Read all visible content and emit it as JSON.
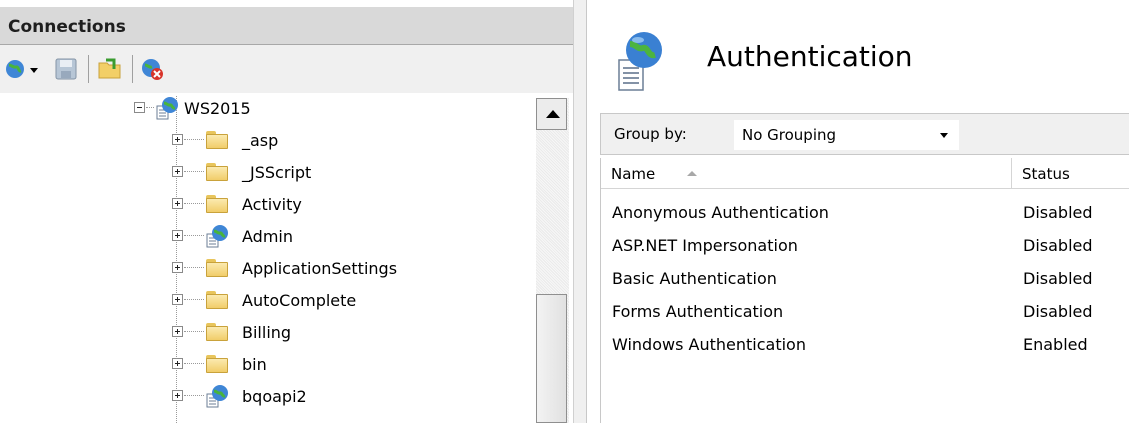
{
  "connections": {
    "title": "Connections",
    "toolbar": [
      {
        "icon": "connect-globe-icon"
      },
      {
        "icon": "save-icon"
      },
      {
        "icon": "open-folder-icon"
      },
      {
        "icon": "disconnect-icon"
      }
    ]
  },
  "tree": {
    "root": {
      "label": "WS2015",
      "icon": "globe-app-icon"
    },
    "items": [
      {
        "label": "_asp",
        "icon": "folder-icon"
      },
      {
        "label": "_JSScript",
        "icon": "folder-icon"
      },
      {
        "label": "Activity",
        "icon": "folder-icon"
      },
      {
        "label": "Admin",
        "icon": "globe-app-icon"
      },
      {
        "label": "ApplicationSettings",
        "icon": "folder-icon"
      },
      {
        "label": "AutoComplete",
        "icon": "folder-icon"
      },
      {
        "label": "Billing",
        "icon": "folder-icon"
      },
      {
        "label": "bin",
        "icon": "folder-icon"
      },
      {
        "label": "bqoapi2",
        "icon": "globe-app-icon"
      }
    ]
  },
  "feature": {
    "title": "Authentication",
    "icon": "authentication-icon",
    "group_by": {
      "label": "Group by:",
      "value": "No Grouping"
    },
    "columns": {
      "name": "Name",
      "status": "Status",
      "sort": "ascending"
    },
    "rows": [
      {
        "name": "Anonymous Authentication",
        "status": "Disabled"
      },
      {
        "name": "ASP.NET Impersonation",
        "status": "Disabled"
      },
      {
        "name": "Basic Authentication",
        "status": "Disabled"
      },
      {
        "name": "Forms Authentication",
        "status": "Disabled"
      },
      {
        "name": "Windows Authentication",
        "status": "Enabled"
      }
    ]
  }
}
